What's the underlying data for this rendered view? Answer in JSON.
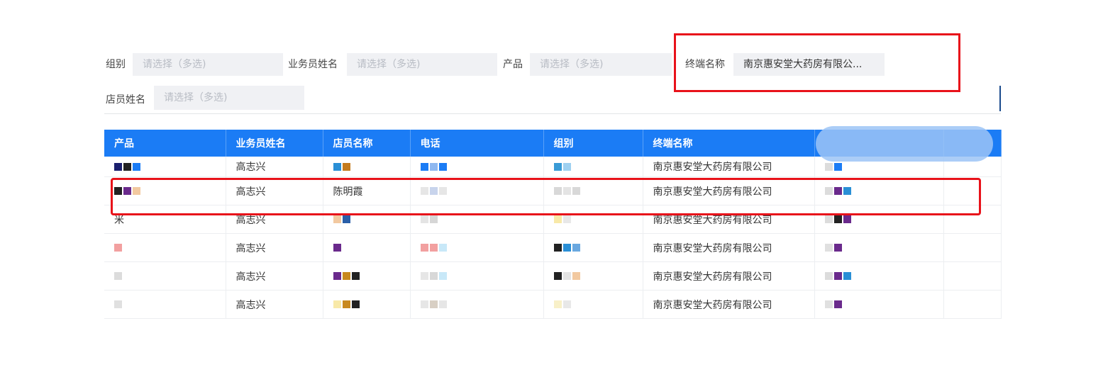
{
  "filters": {
    "group": {
      "label": "组别",
      "placeholder": "请选择（多选)"
    },
    "salesperson": {
      "label": "业务员姓名",
      "placeholder": "请选择（多选)"
    },
    "product": {
      "label": "产品",
      "placeholder": "请选择（多选)"
    },
    "terminal": {
      "label": "终端名称",
      "value": "南京惠安堂大药房有限公..."
    },
    "clerk": {
      "label": "店员姓名",
      "placeholder": "请选择（多选)"
    }
  },
  "table": {
    "columns": [
      "产品",
      "业务员姓名",
      "店员名称",
      "电话",
      "组别",
      "终端名称",
      "",
      ""
    ],
    "rows": [
      {
        "product": "",
        "salesperson": "高志兴",
        "clerk": "",
        "phone": "",
        "group": "",
        "terminal": "南京惠安堂大药房有限公司"
      },
      {
        "product": "",
        "salesperson": "高志兴",
        "clerk": "陈明霞",
        "phone": "",
        "group": "",
        "terminal": "南京惠安堂大药房有限公司"
      },
      {
        "product": "米",
        "salesperson": "高志兴",
        "clerk": "",
        "phone": "",
        "group": "",
        "terminal": "南京惠安堂大药房有限公司"
      },
      {
        "product": "",
        "salesperson": "高志兴",
        "clerk": "",
        "phone": "",
        "group": "",
        "terminal": "南京惠安堂大药房有限公司"
      },
      {
        "product": "",
        "salesperson": "高志兴",
        "clerk": "",
        "phone": "",
        "group": "",
        "terminal": "南京惠安堂大药房有限公司"
      },
      {
        "product": "",
        "salesperson": "高志兴",
        "clerk": "",
        "phone": "",
        "group": "",
        "terminal": "南京惠安堂大药房有限公司"
      }
    ]
  },
  "colors": {
    "header": "#1b7cf5",
    "highlight": "#e8121a"
  }
}
